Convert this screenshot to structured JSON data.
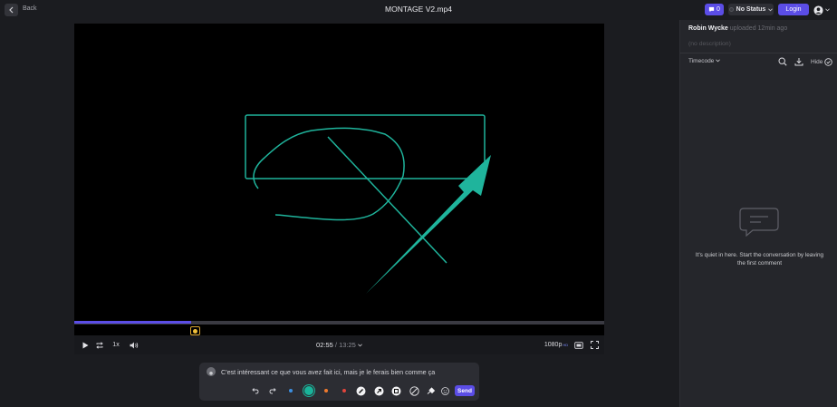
{
  "header": {
    "back_label": "Back",
    "file_title": "MONTAGE V2.mp4",
    "comment_count": "0",
    "status_label": "No Status",
    "login_label": "Login"
  },
  "player": {
    "playback_speed": "1x",
    "current_time": "02:55",
    "duration": "13:25",
    "time_separator": " / ",
    "resolution": "1080p",
    "resolution_badge": "HD",
    "progress_fraction": 0.22,
    "marker_fraction": 0.22
  },
  "composer": {
    "comment_text": "C'est intéressant ce que vous avez fait ici, mais je le ferais bien comme ça",
    "send_label": "Send",
    "colors": [
      "#3d8fe0",
      "#19b39a",
      "#f07a2e",
      "#e2453c"
    ],
    "selected_color": "#19b39a"
  },
  "sidebar": {
    "uploader_name": "Robin Wycke",
    "uploaded_meta": "uploaded 12min ago",
    "description": "(no description)",
    "sort_label": "Timecode",
    "hide_label": "Hide",
    "empty_message": "It's quiet in here. Start the conversation by leaving the first comment"
  },
  "colors": {
    "accent": "#5b4de6",
    "annotation": "#1fb49c",
    "marker": "#f0c03a"
  },
  "icons": [
    "chevron-left-icon",
    "chat-bubble-icon",
    "user-icon",
    "chevron-down-icon",
    "play-icon",
    "loop-icon",
    "volume-icon",
    "theater-mode-icon",
    "fullscreen-icon",
    "undo-icon",
    "redo-icon",
    "pen-icon",
    "arrow-icon",
    "rectangle-icon",
    "eraser-icon",
    "brush-icon",
    "emoji-icon",
    "search-icon",
    "download-icon",
    "check-circle-icon",
    "empty-comments-icon"
  ]
}
